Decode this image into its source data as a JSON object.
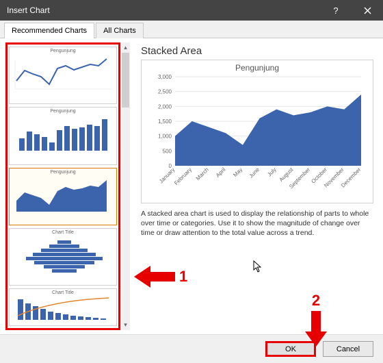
{
  "window": {
    "title": "Insert Chart"
  },
  "tabs": {
    "recommended": "Recommended Charts",
    "all": "All Charts"
  },
  "thumbs_title": "Pengunjung",
  "thumbs_title_alt": "Chart Title",
  "preview": {
    "type_name": "Stacked Area",
    "chart_title": "Pengunjung",
    "description": "A stacked area chart is used to display the relationship of parts to whole over time or categories. Use it to show the magnitude of change over time or draw attention to the total value across a trend."
  },
  "footer": {
    "ok": "OK",
    "cancel": "Cancel"
  },
  "annotations": {
    "one": "1",
    "two": "2"
  },
  "colors": {
    "brand_blue": "#3c64ad",
    "accent_red": "#e60000"
  },
  "chart_data": {
    "type": "area",
    "title": "Pengunjung",
    "xlabel": "",
    "ylabel": "",
    "ylim": [
      0,
      3000
    ],
    "yticks": [
      0,
      500,
      1000,
      1500,
      2000,
      2500,
      3000
    ],
    "categories": [
      "January",
      "February",
      "March",
      "April",
      "May",
      "June",
      "July",
      "August",
      "September",
      "October",
      "November",
      "December"
    ],
    "values": [
      1000,
      1500,
      1300,
      1100,
      700,
      1600,
      1900,
      1700,
      1800,
      2000,
      1900,
      2400
    ]
  }
}
